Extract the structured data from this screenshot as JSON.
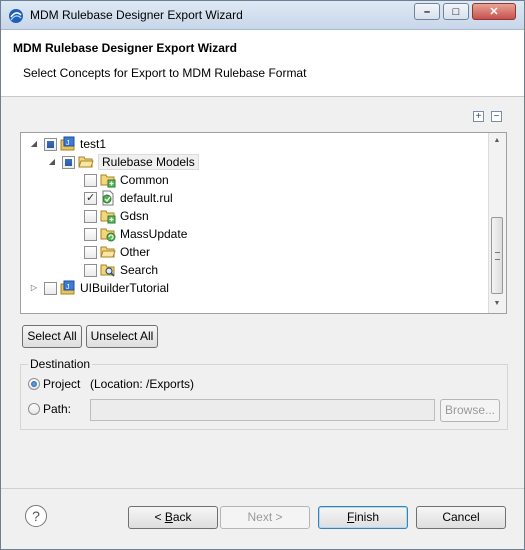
{
  "window": {
    "title": "MDM Rulebase Designer Export Wizard",
    "minimize_glyph": "–",
    "maximize_glyph": "□",
    "close_glyph": "✕"
  },
  "header": {
    "title": "MDM Rulebase Designer Export Wizard",
    "message": "Select Concepts for Export to MDM Rulebase Format"
  },
  "tree_toolbar": {
    "expand_all_glyph": "+",
    "collapse_all_glyph": "−"
  },
  "tree": {
    "items": [
      {
        "label": "test1",
        "state": "partial",
        "expanded": true,
        "icon": "project-icon"
      },
      {
        "label": "Rulebase Models",
        "state": "partial",
        "expanded": true,
        "icon": "open-folder-icon"
      },
      {
        "label": "Common",
        "state": "unchecked",
        "icon": "folder-add-icon"
      },
      {
        "label": "default.rul",
        "state": "checked",
        "icon": "rule-file-icon"
      },
      {
        "label": "Gdsn",
        "state": "unchecked",
        "icon": "folder-add-icon"
      },
      {
        "label": "MassUpdate",
        "state": "unchecked",
        "icon": "folder-refresh-icon"
      },
      {
        "label": "Other",
        "state": "unchecked",
        "icon": "open-folder-icon"
      },
      {
        "label": "Search",
        "state": "unchecked",
        "icon": "search-folder-icon"
      },
      {
        "label": "UIBuilderTutorial",
        "state": "unchecked",
        "expanded": false,
        "icon": "project-icon"
      }
    ]
  },
  "selection_buttons": {
    "select_all": "Select All",
    "unselect_all": "Unselect All"
  },
  "destination": {
    "legend": "Destination",
    "project_label": "Project",
    "project_location": "(Location: /Exports)",
    "path_label": "Path:",
    "path_value": "",
    "browse_label": "Browse...",
    "selected": "project"
  },
  "footer": {
    "help_glyph": "?",
    "back_prefix": "< ",
    "back_mnemonic": "B",
    "back_rest": "ack",
    "next_label": "Next >",
    "finish_mnemonic": "F",
    "finish_rest": "inish",
    "cancel_label": "Cancel"
  },
  "colors": {
    "accent": "#3c7fb1",
    "checkbox_partial": "#2a58a3",
    "folder": "#e8c45a"
  }
}
